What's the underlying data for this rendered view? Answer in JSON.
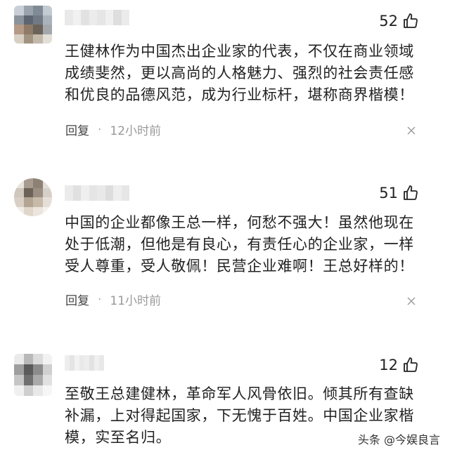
{
  "comments": [
    {
      "likes": "52",
      "text": "王健林作为中国杰出企业家的代表，不仅在商业领域\n成绩斐然，更以高尚的人格魅力、强烈的社会责任感\n和优良的品德风范，成为行业标杆，堪称商界楷模！",
      "reply_label": "回复",
      "separator": "·",
      "time": "12小时前"
    },
    {
      "likes": "51",
      "text": "中国的企业都像王总一样，何愁不强大！虽然他现在\n处于低潮，但他是有良心，有责任心的企业家，一样\n受人尊重，受人敬佩！民营企业难啊！王总好样的！",
      "reply_label": "回复",
      "separator": "·",
      "time": "11小时前"
    },
    {
      "likes": "12",
      "text": "至敬王总建健林，革命军人风骨依旧。倾其所有查缺\n补漏，上对得起国家，下无愧于百姓。中国企业家楷\n模，实至名归。",
      "reply_label": "回复",
      "separator": "·",
      "time": ""
    }
  ],
  "watermark": "头条 @今娱良言",
  "colors": {
    "text": "#222222",
    "meta": "#9a9a9a",
    "background": "#ffffff"
  },
  "icons": {
    "like": "thumbs-up-icon",
    "close": "close-icon"
  }
}
